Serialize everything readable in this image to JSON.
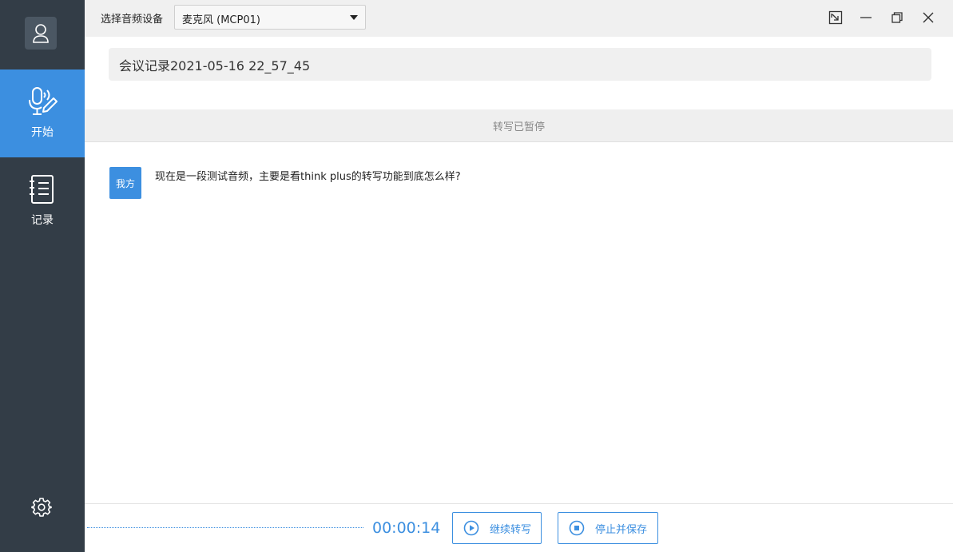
{
  "sidebar": {
    "nav_start_label": "开始",
    "nav_records_label": "记录",
    "active_color": "#3c8fe0",
    "bg_color": "#333d47"
  },
  "topbar": {
    "device_label": "选择音频设备",
    "device_selected": "麦克风 (MCP01)"
  },
  "main": {
    "title_value": "会议记录2021-05-16 22_57_45",
    "status_text": "转写已暂停",
    "transcript": [
      {
        "speaker": "我方",
        "text": "现在是一段测试音频，主要是看think plus的转写功能到底怎么样?"
      }
    ]
  },
  "footer": {
    "timer": "00:00:14",
    "continue_label": "继续转写",
    "stop_save_label": "停止并保存"
  },
  "icons": {
    "avatar": "user-icon",
    "start": "microphone-pen-icon",
    "records": "notebook-icon",
    "settings": "gear-icon",
    "pin": "pin-window-icon",
    "minimize": "minimize-icon",
    "restore": "restore-icon",
    "close": "close-icon",
    "continue": "play-icon",
    "stop": "stop-icon"
  }
}
